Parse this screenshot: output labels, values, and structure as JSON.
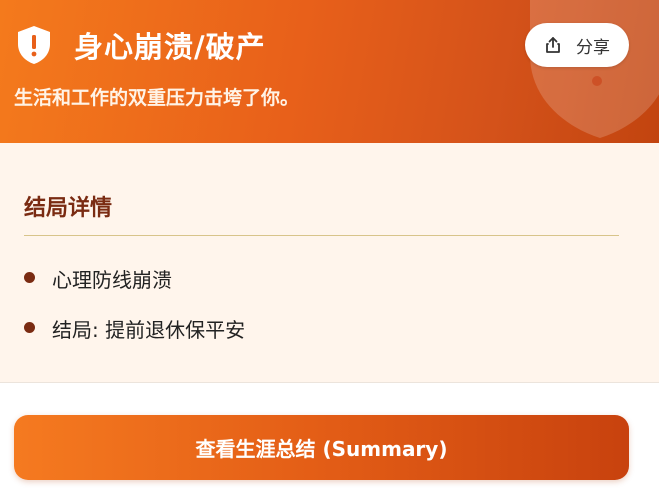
{
  "header": {
    "title": "身心崩溃/破产",
    "subtitle": "生活和工作的双重压力击垮了你。",
    "share_label": "分享",
    "icon": "shield-alert-icon",
    "background_icon": "shield-icon"
  },
  "details": {
    "title": "结局详情",
    "items": [
      {
        "text": "心理防线崩溃"
      },
      {
        "text": "结局: 提前退休保平安"
      }
    ]
  },
  "footer": {
    "summary_button_label": "查看生涯总结 (Summary)"
  },
  "colors": {
    "header_gradient_start": "#f47a1c",
    "header_gradient_end": "#c2440f",
    "details_background": "#fff5ec",
    "accent_dark": "#7a2b12",
    "divider": "#d8c48a"
  }
}
